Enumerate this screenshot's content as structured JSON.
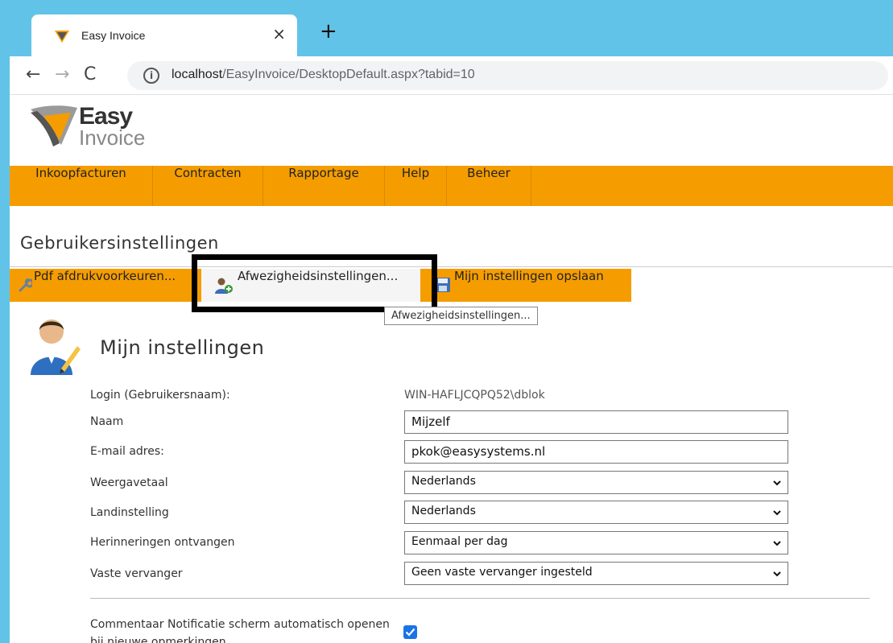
{
  "browser": {
    "tab_title": "Easy Invoice",
    "tab_close": "×",
    "new_tab": "+",
    "url_host": "localhost",
    "url_path": "/EasyInvoice/DesktopDefault.aspx?tabid=10"
  },
  "logo": {
    "line1": "Easy",
    "line2": "Invoice"
  },
  "menu": [
    "Inkoopfacturen",
    "Contracten",
    "Rapportage",
    "Help",
    "Beheer"
  ],
  "page_title": "Gebruikersinstellingen",
  "toolbar": {
    "pdf": "Pdf afdrukvoorkeuren...",
    "afwezigheid": "Afwezigheidsinstellingen...",
    "opslaan": "Mijn instellingen opslaan"
  },
  "tooltip": "Afwezigheidsinstellingen...",
  "section_title": "Mijn instellingen",
  "form": {
    "login_label": "Login (Gebruikersnaam):",
    "login_value": "WIN-HAFLJCQPQ52\\dblok",
    "naam_label": "Naam",
    "naam_value": "Mijzelf",
    "email_label": "E-mail adres:",
    "email_value": "pkok@easysystems.nl",
    "weergavetaal_label": "Weergavetaal",
    "weergavetaal_value": "Nederlands",
    "landinstelling_label": "Landinstelling",
    "landinstelling_value": "Nederlands",
    "herinneringen_label": "Herinneringen ontvangen",
    "herinneringen_value": "Eenmaal per dag",
    "vervanger_label": "Vaste vervanger",
    "vervanger_value": "Geen vaste vervanger ingesteld",
    "comment_label": "Commentaar Notificatie scherm automatisch openen bij nieuwe opmerkingen",
    "comment_checked": true
  },
  "colors": {
    "accent": "#f59d00",
    "browser": "#62c3e8",
    "checkbox": "#1a73e8"
  }
}
